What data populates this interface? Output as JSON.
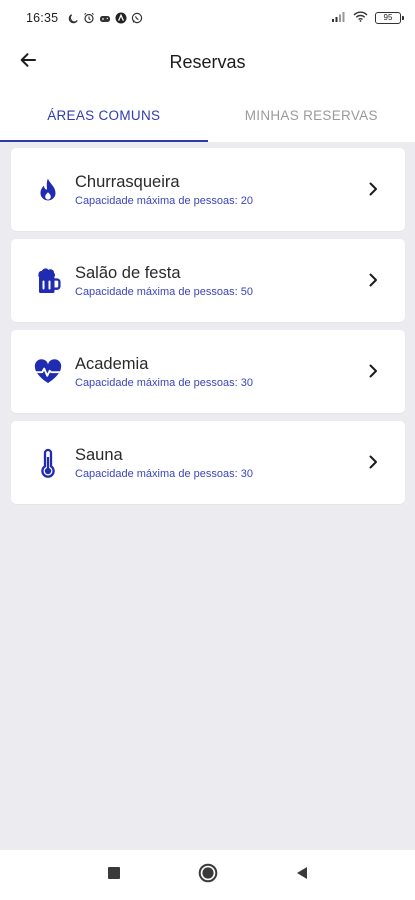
{
  "status_bar": {
    "time": "16:35",
    "battery": "95",
    "icons": [
      "moon-icon",
      "alarm-icon",
      "gamepad-icon",
      "app-icon",
      "whatsapp-icon",
      "signal-icon",
      "wifi-icon",
      "battery-icon"
    ]
  },
  "header": {
    "title": "Reservas",
    "back_icon": "arrow-left-icon"
  },
  "tabs": [
    {
      "label": "ÁREAS COMUNS",
      "active": true
    },
    {
      "label": "MINHAS RESERVAS",
      "active": false
    }
  ],
  "areas": [
    {
      "name": "Churrasqueira",
      "capacity": "Capacidade máxima de pessoas: 20",
      "icon": "flame-icon"
    },
    {
      "name": "Salão de festa",
      "capacity": "Capacidade máxima de pessoas: 50",
      "icon": "beer-mug-icon"
    },
    {
      "name": "Academia",
      "capacity": "Capacidade máxima de pessoas: 30",
      "icon": "heartbeat-icon"
    },
    {
      "name": "Sauna",
      "capacity": "Capacidade máxima de pessoas: 30",
      "icon": "thermometer-icon"
    }
  ],
  "colors": {
    "accent": "#2d3bb0",
    "icon": "#1f2bb0",
    "background": "#ECECF0",
    "inactive_tab": "#9a9a9a"
  }
}
